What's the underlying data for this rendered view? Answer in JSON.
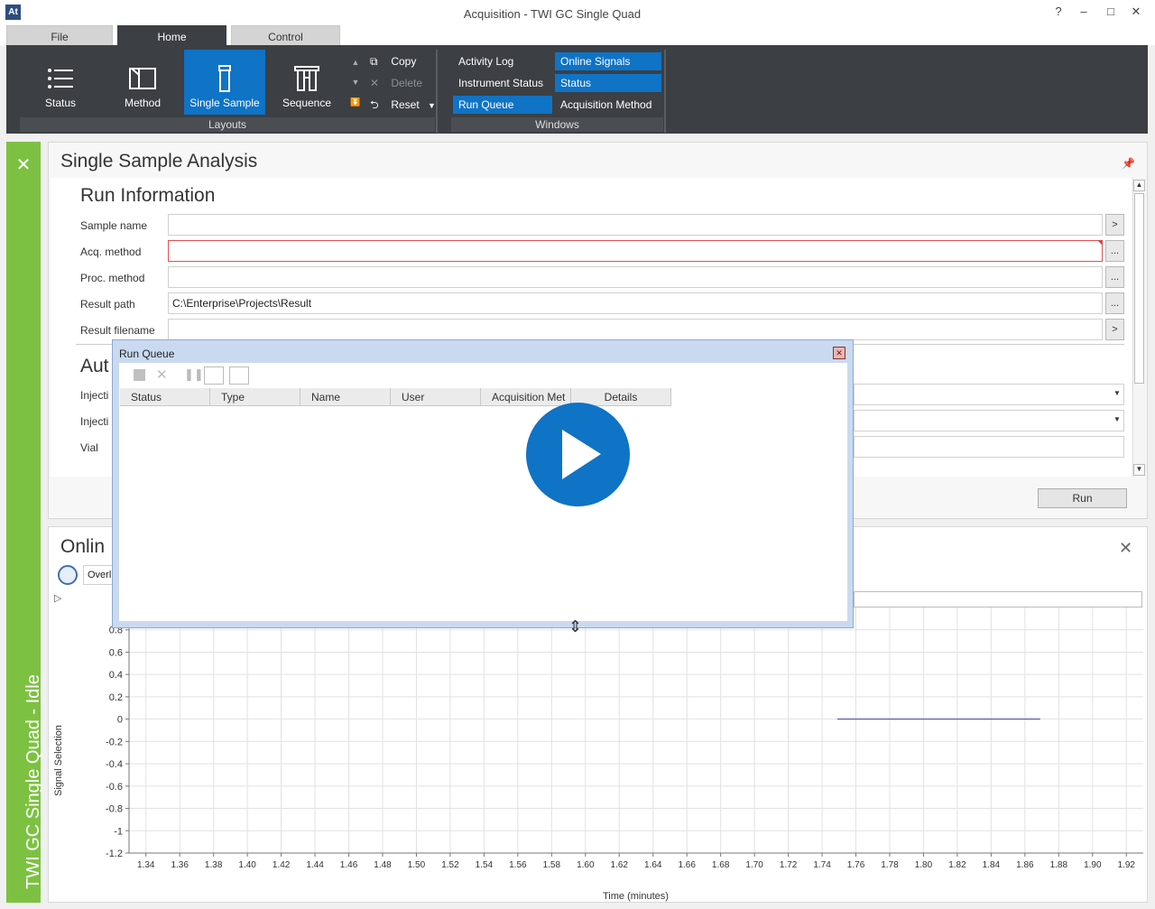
{
  "window": {
    "title": "Acquisition - TWI GC Single Quad",
    "app_icon": "At",
    "help": "?",
    "minimize": "–",
    "maximize": "□",
    "close": "✕"
  },
  "tabs": [
    {
      "label": "File",
      "active": false
    },
    {
      "label": "Home",
      "active": true
    },
    {
      "label": "Control",
      "active": false
    }
  ],
  "ribbon": {
    "layouts": {
      "status": "Status",
      "method": "Method",
      "single_sample": "Single Sample",
      "sequence": "Sequence",
      "copy": "Copy",
      "delete": "Delete",
      "reset": "Reset",
      "group_label": "Layouts"
    },
    "windows": {
      "activity_log": "Activity Log",
      "online_signals": "Online Signals",
      "instrument_status": "Instrument Status",
      "status": "Status",
      "run_queue": "Run Queue",
      "acquisition_method": "Acquisition Method",
      "group_label": "Windows"
    },
    "accent": "#0f73c6"
  },
  "sidebar": {
    "label": "TWI GC Single Quad - Idle",
    "close": "✕",
    "color": "#7dc142"
  },
  "single_sample": {
    "title": "Single Sample Analysis",
    "run_info_title": "Run Information",
    "fields": {
      "sample_name": {
        "label": "Sample name",
        "value": "",
        "btn": ">"
      },
      "acq_method": {
        "label": "Acq. method",
        "value": "",
        "btn": "..."
      },
      "proc_method": {
        "label": "Proc. method",
        "value": "",
        "btn": "..."
      },
      "result_path": {
        "label": "Result path",
        "value": "C:\\Enterprise\\Projects\\Result",
        "btn": "..."
      },
      "result_filename": {
        "label": "Result filename",
        "value": "",
        "btn": ">"
      }
    },
    "auto_title": "Aut",
    "injection1_label": "Injecti",
    "injection2_label": "Injecti",
    "vial_label": "Vial",
    "run_button": "Run"
  },
  "online": {
    "title": "Onlin",
    "overlay_value": "Overl",
    "close": "✕",
    "y_axis_label": "Signal Selection",
    "x_axis_label": "Time (minutes)"
  },
  "run_queue": {
    "title": "Run Queue",
    "close": "✕",
    "columns": [
      "Status",
      "Type",
      "Name",
      "User",
      "Acquisition Met",
      "Details"
    ]
  },
  "chart_data": {
    "type": "line",
    "xlabel": "Time (minutes)",
    "ylabel": "Signal Selection",
    "y_ticks": [
      "0.8",
      "0.6",
      "0.4",
      "0.2",
      "0",
      "-0.2",
      "-0.4",
      "-0.6",
      "-0.8",
      "-1",
      "-1.2"
    ],
    "x_ticks": [
      "1.34",
      "1.36",
      "1.38",
      "1.40",
      "1.42",
      "1.44",
      "1.46",
      "1.48",
      "1.50",
      "1.52",
      "1.54",
      "1.56",
      "1.58",
      "1.60",
      "1.62",
      "1.64",
      "1.66",
      "1.68",
      "1.70",
      "1.72",
      "1.74",
      "1.76",
      "1.78",
      "1.80",
      "1.82",
      "1.84",
      "1.86",
      "1.88",
      "1.90",
      "1.92"
    ],
    "series": [
      {
        "x": [
          1.749,
          1.869
        ],
        "y": [
          0,
          0
        ],
        "color": "#3a3a9a"
      }
    ],
    "xlim": [
      1.33,
      1.93
    ],
    "ylim": [
      -1.2,
      1.0
    ],
    "grid": true
  }
}
